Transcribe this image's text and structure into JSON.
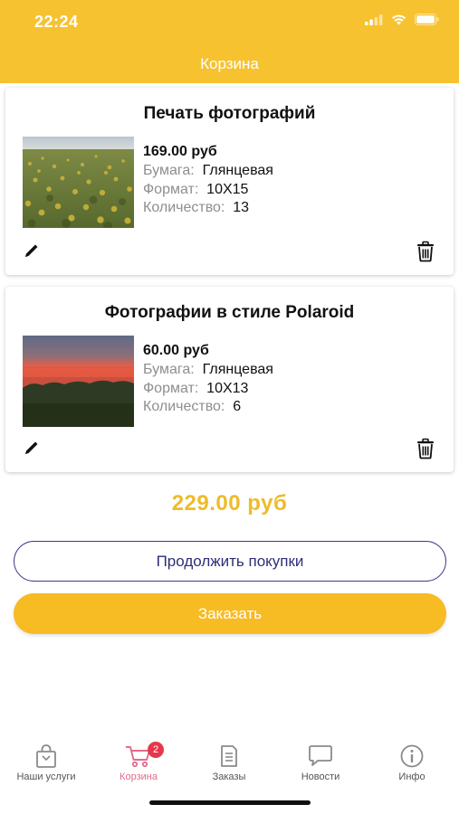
{
  "status_bar": {
    "time": "22:24"
  },
  "header": {
    "title": "Корзина"
  },
  "cart_items": [
    {
      "title": "Печать фотографий",
      "price": "169.00 руб",
      "paper_label": "Бумага:",
      "paper_value": "Глянцевая",
      "format_label": "Формат:",
      "format_value": "10X15",
      "quantity_label": "Количество:",
      "quantity_value": "13"
    },
    {
      "title": "Фотографии в стиле Polaroid",
      "price": "60.00 руб",
      "paper_label": "Бумага:",
      "paper_value": "Глянцевая",
      "format_label": "Формат:",
      "format_value": "10X13",
      "quantity_label": "Количество:",
      "quantity_value": "6"
    }
  ],
  "total": "229.00  руб",
  "buttons": {
    "continue_label": "Продолжить покупки",
    "order_label": "Заказать"
  },
  "tabbar": {
    "tabs": [
      {
        "label": "Наши услуги",
        "icon": "shopping-bag-icon"
      },
      {
        "label": "Корзина",
        "icon": "cart-icon",
        "badge": "2",
        "active": true
      },
      {
        "label": "Заказы",
        "icon": "orders-icon"
      },
      {
        "label": "Новости",
        "icon": "chat-icon"
      },
      {
        "label": "Инфо",
        "icon": "info-icon"
      }
    ]
  },
  "colors": {
    "accent": "#f7c22f",
    "order_button": "#f7bb24",
    "total_text": "#efbb2a",
    "active_tab": "#e46a8b",
    "badge": "#e5394b",
    "continue_border": "#3a3a8c"
  }
}
